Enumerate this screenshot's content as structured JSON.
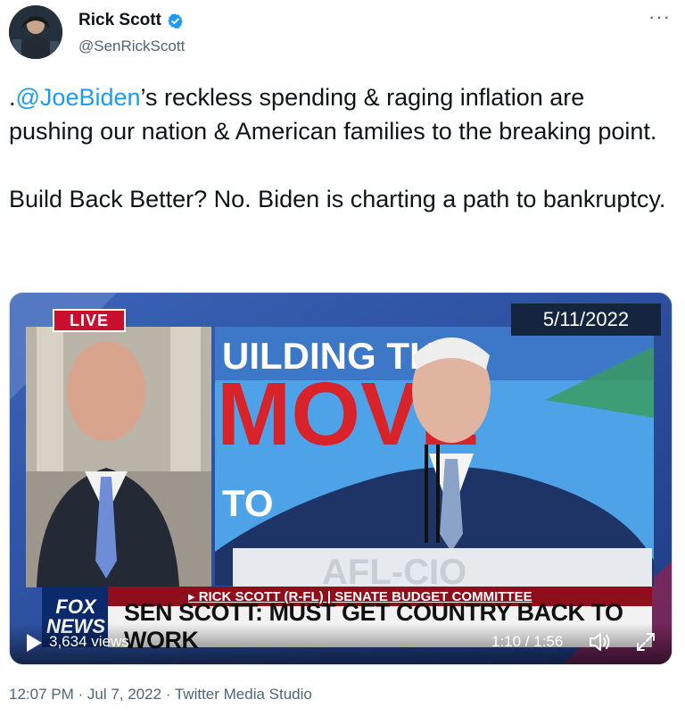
{
  "author": {
    "name": "Rick Scott",
    "handle": "@SenRickScott",
    "verified_icon": "verified-badge-icon",
    "more_icon": "more-options-icon",
    "more_label": "···"
  },
  "tweet": {
    "prefix": ".",
    "mention": "@JoeBiden",
    "text_after_mention": "’s reckless spending & raging inflation are pushing our nation & American families to the breaking point.",
    "paragraph2": "Build Back Better? No. Biden is charting a path to bankruptcy."
  },
  "media": {
    "live_label": "LIVE",
    "date_label": "5/11/2022",
    "banner_top_line1": "UILDING THE",
    "banner_big": "MOVE",
    "banner_bottom": "TO",
    "podium_text": "AFL-CIO",
    "fox_logo_line1": "FOX",
    "fox_logo_line2": "NEWS",
    "lower_third_top": "▸ RICK SCOTT (R-FL) | SENATE BUDGET COMMITTEE",
    "lower_third_main": "SEN SCOTT: MUST GET COUNTRY BACK TO WORK",
    "views": "3,634 views",
    "time": "1:10 / 1:56",
    "play_icon": "play-icon",
    "volume_icon": "volume-icon",
    "fullscreen_icon": "fullscreen-icon"
  },
  "footer": {
    "meta": "12:07 PM · Jul 7, 2022 · Twitter Media Studio"
  },
  "colors": {
    "link": "#1d9bf0",
    "secondary_text": "#536471",
    "live_red": "#c8102e",
    "banner_dark_red": "#8e0f1b"
  }
}
